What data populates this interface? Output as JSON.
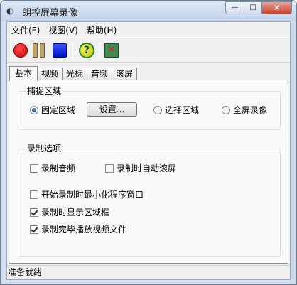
{
  "window": {
    "title": "朗控屏幕录像",
    "min_glyph": "—",
    "max_glyph": "□",
    "close_glyph": "✕"
  },
  "menu": {
    "items": [
      {
        "label": "文件(F)"
      },
      {
        "label": "视图(V)"
      },
      {
        "label": "帮助(H)"
      }
    ]
  },
  "toolbar": {
    "help_glyph": "?",
    "exit_glyph": "✕"
  },
  "tabs": [
    {
      "label": "基本",
      "active": true
    },
    {
      "label": "视频",
      "active": false
    },
    {
      "label": "光标",
      "active": false
    },
    {
      "label": "音频",
      "active": false
    },
    {
      "label": "滚屏",
      "active": false
    }
  ],
  "capture": {
    "title": "捕捉区域",
    "fixed_label": "固定区域",
    "setup_label": "设置...",
    "select_label": "选择区域",
    "fullscreen_label": "全屏录像",
    "selected": "fixed"
  },
  "options": {
    "title": "录制选项",
    "record_audio": {
      "label": "录制音频",
      "checked": false
    },
    "auto_scroll": {
      "label": "录制时自动滚屏",
      "checked": false
    },
    "minimize": {
      "label": "开始录制时最小化程序窗口",
      "checked": false
    },
    "show_frame": {
      "label": "录制时显示区域框",
      "checked": true
    },
    "play_after": {
      "label": "录制完毕播放视频文件",
      "checked": true
    }
  },
  "status": {
    "text": "准备就绪"
  },
  "colors": {
    "record": "#e00000",
    "stop": "#0018e0",
    "radio_selected": "#3b6fb5"
  }
}
